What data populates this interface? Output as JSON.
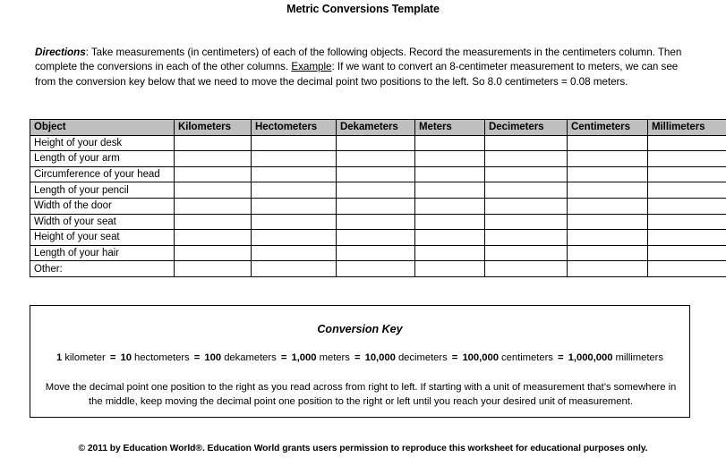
{
  "document": {
    "title": "Metric Conversions Template",
    "directions": {
      "label": "Directions",
      "label_suffix": ":",
      "part1": " Take measurements (in centimeters) of each of the following objects. Record the measurements in the centimeters column. Then complete the conversions in each of the other columns. ",
      "example_label": "Example",
      "part2": ": If we want to convert an 8-centimeter measurement to meters, we can see from the conversion key below that we need to move the decimal point two positions to the left. So 8.0 centimeters = 0.08 meters."
    }
  },
  "table": {
    "headers": [
      "Object",
      "Kilometers",
      "Hectometers",
      "Dekameters",
      "Meters",
      "Decimeters",
      "Centimeters",
      "Millimeters"
    ],
    "rows": [
      {
        "object": "Height of your desk"
      },
      {
        "object": "Length of your arm"
      },
      {
        "object": "Circumference of your head"
      },
      {
        "object": "Length of your pencil"
      },
      {
        "object": "Width of the door"
      },
      {
        "object": "Width of your seat"
      },
      {
        "object": "Height of your seat"
      },
      {
        "object": "Length of your hair"
      },
      {
        "object": "Other:"
      }
    ],
    "header_background": "#bfbfbf",
    "border_color": "#000000"
  },
  "conversion_key": {
    "title": "Conversion Key",
    "equation": [
      {
        "number": "1",
        "unit": "kilometer"
      },
      {
        "number": "10",
        "unit": "hectometers"
      },
      {
        "number": "100",
        "unit": "dekameters"
      },
      {
        "number": "1,000",
        "unit": "meters"
      },
      {
        "number": "10,000",
        "unit": "decimeters"
      },
      {
        "number": "100,000",
        "unit": "centimeters"
      },
      {
        "number": "1,000,000",
        "unit": "millimeters"
      }
    ],
    "equals_sign": "=",
    "note": "Move the decimal point one position to the right as you read across from right to left. If starting with a unit of measurement that’s somewhere in the middle, keep moving the decimal point one position to the right or left until you reach your desired unit of measurement."
  },
  "footer": {
    "copyright": "© 2011 by Education World®. Education World grants users permission to reproduce this worksheet for educational purposes only."
  }
}
